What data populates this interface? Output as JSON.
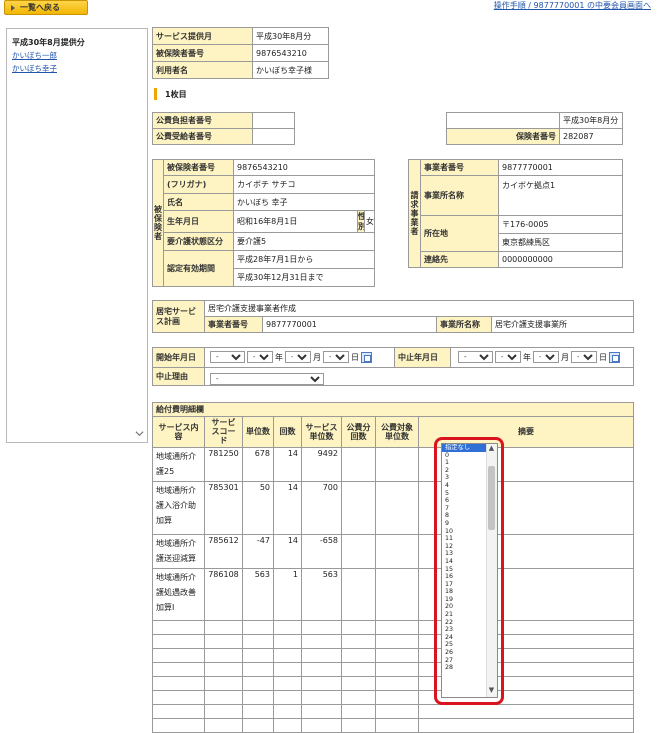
{
  "topbar": {
    "back_label": "一覧へ戻る",
    "link_text": "操作手順 / 9877770001 の中要会員画面へ"
  },
  "sidebar": {
    "heading": "平成30年8月提供分",
    "items": [
      "かいぼち一郎",
      "かいぼち幸子"
    ]
  },
  "top_info": [
    {
      "label": "サービス提供月",
      "value": "平成30年8月分"
    },
    {
      "label": "被保険者番号",
      "value": "9876543210"
    },
    {
      "label": "利用者名",
      "value": "かいぼち幸子様"
    }
  ],
  "section_title": "1枚目",
  "public_expense": {
    "payer_label": "公費負担者番号",
    "payer_value": "",
    "recipient_label": "公費受給者番号",
    "recipient_value": "",
    "month_value": "平成30年8月分",
    "insurer_label": "保険者番号",
    "insurer_value": "282087"
  },
  "insured": {
    "group_label": "被保険者",
    "rows": [
      {
        "label": "被保険者番号",
        "value": "9876543210"
      },
      {
        "label": "(フリガナ)",
        "value": "カイボチ サチコ"
      },
      {
        "label": "氏名",
        "value": "かいぼち 幸子"
      },
      {
        "label": "生年月日",
        "value": "昭和16年8月1日"
      }
    ],
    "sex_label": "性別",
    "sex_value": "女",
    "care_level_label": "要介護状態区分",
    "care_level_value": "要介護5",
    "cert_label": "認定有効期間",
    "cert_from": "平成28年7月1日から",
    "cert_to": "平成30年12月31日まで"
  },
  "provider": {
    "group_label": "請求事業者",
    "id_label": "事業者番号",
    "id_value": "9877770001",
    "name_label": "事業所名称",
    "name_value": "カイボケ拠点1",
    "address_label": "所在地",
    "postal": "〒176-0005",
    "address": "東京都練馬区",
    "contact_label": "連絡先",
    "contact_value": "0000000000"
  },
  "care_plan": {
    "label": "居宅サービス計画",
    "value": "居宅介護支援事業者作成",
    "id_label": "事業者番号",
    "id_value": "9877770001",
    "name_label": "事業所名称",
    "name_value": "居宅介護支援事業所"
  },
  "dates": {
    "start_label": "開始年月日",
    "stop_label": "中止年月日",
    "reason_label": "中止理由",
    "year_suffix": "年",
    "month_suffix": "月",
    "day_suffix": "日",
    "blank_option": "-"
  },
  "benefit": {
    "title": "給付費明細欄",
    "headers": [
      "サービス内容",
      "サービスコード",
      "単位数",
      "回数",
      "サービス単位数",
      "公費分回数",
      "公費対象単位数",
      "摘要"
    ],
    "rows": [
      {
        "name": "地域通所介護25",
        "code": "781250",
        "unit": "678",
        "count": "14",
        "total": "9492"
      },
      {
        "name": "地域通所介護入浴介助加算",
        "code": "785301",
        "unit": "50",
        "count": "14",
        "total": "700"
      },
      {
        "name": "地域通所介護送迎減算",
        "code": "785612",
        "unit": "-47",
        "count": "14",
        "total": "-658"
      },
      {
        "name": "地域通所介護処遇改善加算Ⅰ",
        "code": "786108",
        "unit": "563",
        "count": "1",
        "total": "563"
      }
    ]
  },
  "listbox": {
    "options": [
      "指定なし",
      "0",
      "1",
      "2",
      "3",
      "4",
      "5",
      "6",
      "7",
      "8",
      "9",
      "10",
      "11",
      "12",
      "13",
      "14",
      "15",
      "16",
      "17",
      "18",
      "19",
      "20",
      "21",
      "22",
      "23",
      "24",
      "25",
      "26",
      "27",
      "28"
    ],
    "selected": "指定なし"
  },
  "colors": {
    "label_bg": "#fdf3c3",
    "button": "#f2b705",
    "highlight": "#d9141e",
    "link": "#2255aa"
  }
}
